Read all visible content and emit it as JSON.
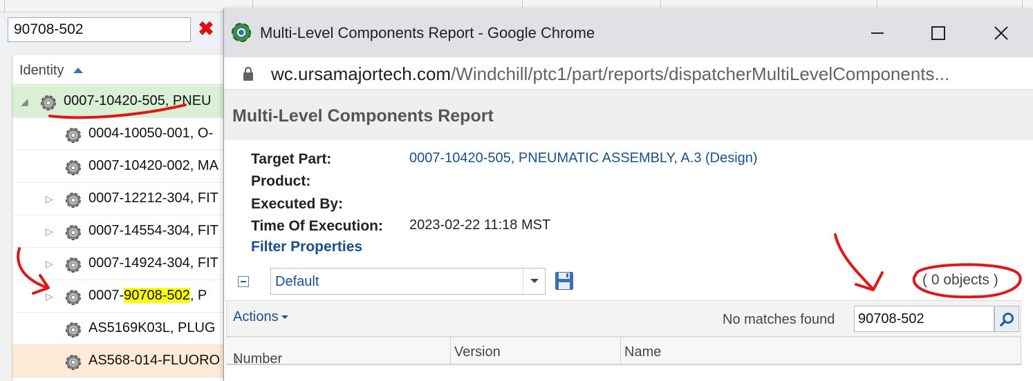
{
  "background": {
    "search_value": "90708-502",
    "clear_label": "✖",
    "column_header": "Identity",
    "tree_rows": [
      {
        "text": "0007-10420-505, PNEU",
        "toggle": "◢"
      },
      {
        "text": "0004-10050-001, O-",
        "toggle": ""
      },
      {
        "text": "0007-10420-002, MA",
        "toggle": ""
      },
      {
        "text": "0007-12212-304, FIT",
        "toggle": "▷"
      },
      {
        "text": "0007-14554-304, FIT",
        "toggle": "▷"
      },
      {
        "text": "0007-14924-304, FIT",
        "toggle": "▷"
      },
      {
        "text_pre": "0007-",
        "text_hl": "90708-502",
        "text_post": ", P",
        "toggle": "▷"
      },
      {
        "text": "AS5169K03L, PLUG",
        "toggle": ""
      },
      {
        "text": "AS568-014-FLUORO",
        "toggle": ""
      }
    ]
  },
  "chrome": {
    "window_title": "Multi-Level Components Report - Google Chrome",
    "url_host": "wc.ursamajortech.com",
    "url_path": "/Windchill/ptc1/part/reports/dispatcherMultiLevelComponents...",
    "icons": [
      "chrome-logo-icon",
      "minimize-icon",
      "maximize-icon",
      "close-icon",
      "lock-icon"
    ]
  },
  "report": {
    "title": "Multi-Level Components Report",
    "target_part_label": "Target Part:",
    "target_part_value": "0007-10420-505, PNEUMATIC ASSEMBLY, A.3 (Design)",
    "product_label": "Product:",
    "executed_by_label": "Executed By:",
    "time_label": "Time Of Execution:",
    "time_value": "2023-02-22 11:18 MST",
    "filter_properties": "Filter Properties",
    "view_value": "Default",
    "object_count": "( 0 objects )",
    "actions_label": "Actions",
    "no_matches": "No matches found",
    "find_value": "90708-502",
    "columns": [
      "Number",
      "Version",
      "Name"
    ],
    "sort_indicator": "↓"
  },
  "annotation_color": "#e0161a"
}
